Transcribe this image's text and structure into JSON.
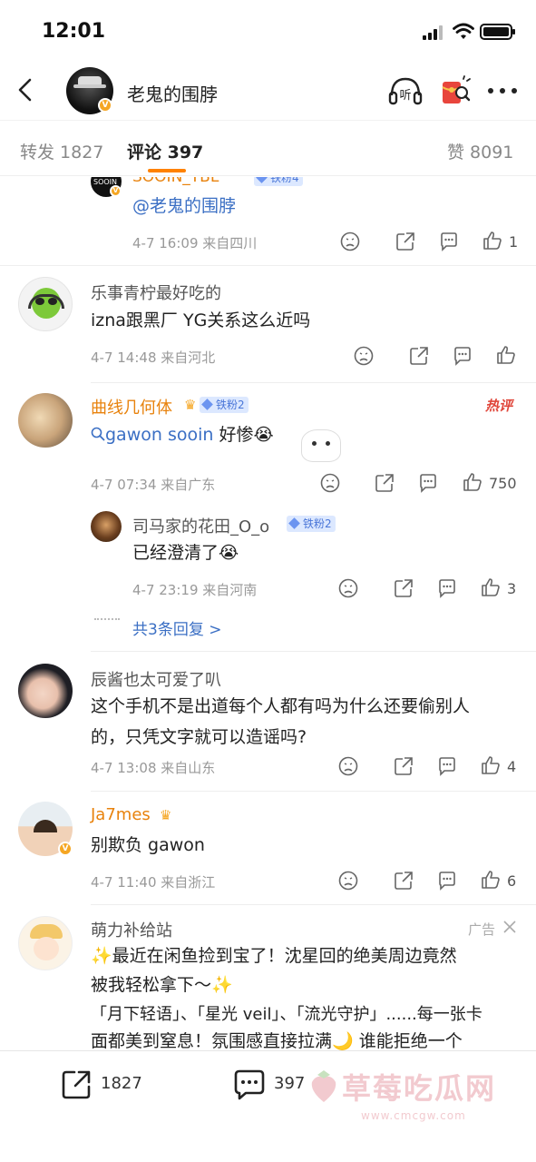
{
  "status_bar": {
    "time": "12:01"
  },
  "header": {
    "title": "老鬼的围脖"
  },
  "tabs": [
    {
      "label": "转发 1827"
    },
    {
      "label": "评论 397"
    },
    {
      "label": "赞 8091"
    }
  ],
  "comments": {
    "c0": {
      "name": "SOOIN_YBL",
      "fan": "铁粉4",
      "text": "@老鬼的围脖",
      "meta": "4-7 16:09 来自四川",
      "likes": "1"
    },
    "c1": {
      "name": "乐事青柠最好吃的",
      "text": "izna跟黑厂 YG关系这么近吗",
      "meta": "4-7 14:48 来自河北"
    },
    "c2": {
      "name": "曲线几何体",
      "fan": "铁粉2",
      "hot": "热评",
      "link": "gawon sooin",
      "text_rest": " 好惨",
      "emoji": "😭",
      "meta": "4-7 07:34 来自广东",
      "likes": "750"
    },
    "r1": {
      "name": "司马家的花田_O_o",
      "fan": "铁粉2",
      "text": "已经澄清了",
      "emoji": "😭",
      "meta": "4-7 23:19 来自河南",
      "likes": "3",
      "more": "共3条回复 >"
    },
    "c3": {
      "name": "辰酱也太可爱了叭",
      "line1": "这个手机不是出道每个人都有吗为什么还要偷别人",
      "line2": "的，只凭文字就可以造谣吗?",
      "meta": "4-7 13:08 来自山东",
      "likes": "4"
    },
    "c4": {
      "name": "Ja7mes",
      "text": "别欺负 gawon",
      "meta": "4-7 11:40 来自浙江",
      "likes": "6"
    },
    "ad": {
      "name": "萌力补给站",
      "tag": "广告",
      "line1": "✨最近在闲鱼捡到宝了！沈星回的绝美周边竟然",
      "line2": "被我轻松拿下～✨",
      "line3": "「月下轻语」、「星光 veil」、「流光守护」......每一张卡",
      "line4": "面都美到窒息！氛围感直接拉满🌙 谁能拒绝一个"
    }
  },
  "bottom_bar": {
    "repost_count": "1827",
    "comment_count": "397"
  },
  "watermark": {
    "text": "草莓吃瓜网",
    "url": "www.cmcgw.com"
  },
  "colors": {
    "accent": "#ff8200",
    "link": "#3b6fc4",
    "hot": "#e0463a"
  }
}
